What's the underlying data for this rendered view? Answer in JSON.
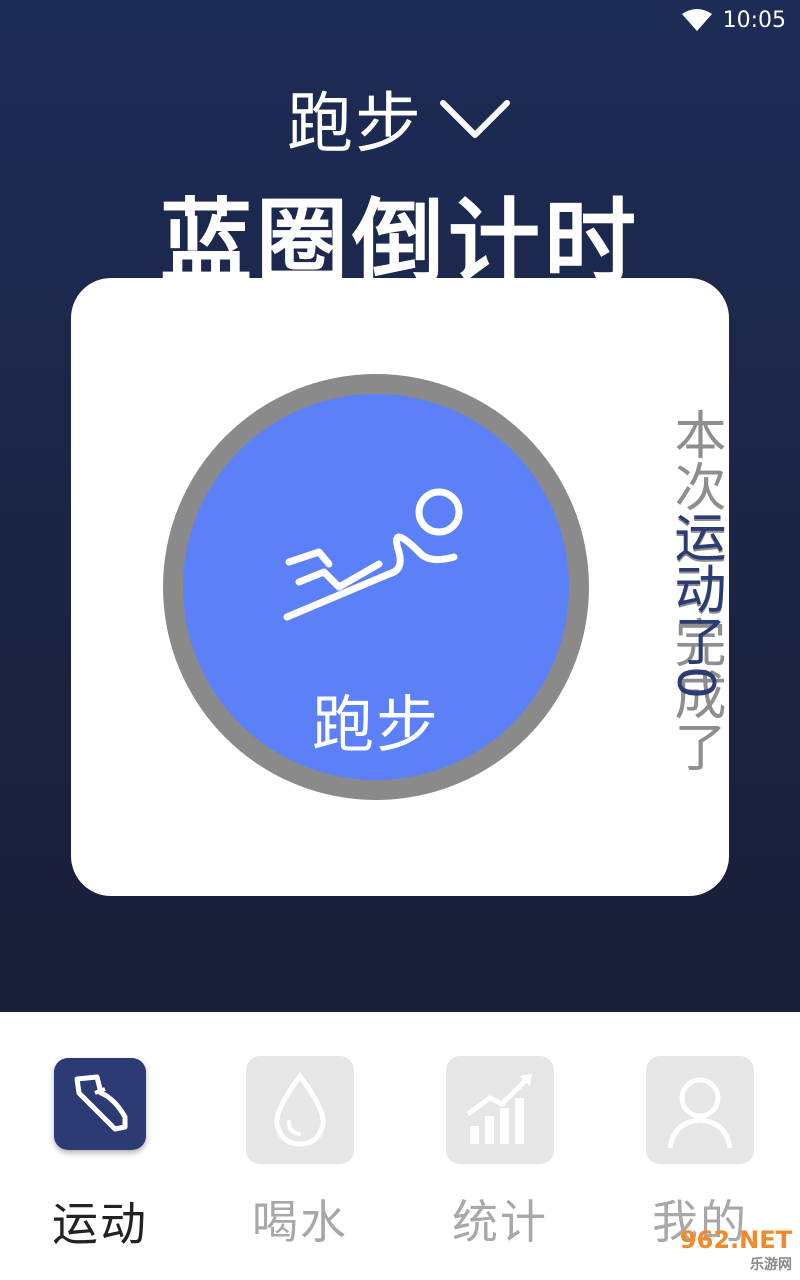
{
  "status_bar": {
    "time": "10:05",
    "wifi_icon": "wifi-icon"
  },
  "header": {
    "mode": "跑步",
    "dropdown_icon": "chevron-down-icon",
    "title": "蓝圈倒计时"
  },
  "card": {
    "activity_icon": "runner-icon",
    "activity_label": "跑步",
    "vertical_text_grey": "本次运动完成了",
    "vertical_text_blue": "运动了0"
  },
  "nav": {
    "items": [
      {
        "label": "运动",
        "icon": "shoe-icon",
        "active": true
      },
      {
        "label": "喝水",
        "icon": "water-drop-icon",
        "active": false
      },
      {
        "label": "统计",
        "icon": "stats-icon",
        "active": false
      },
      {
        "label": "我的",
        "icon": "person-icon",
        "active": false
      }
    ]
  },
  "watermark": {
    "text": "962.NET",
    "sub": "乐游网"
  },
  "colors": {
    "accent": "#5b80f7",
    "nav_active": "#2c3b74",
    "bg_dark": "#1b2444"
  }
}
